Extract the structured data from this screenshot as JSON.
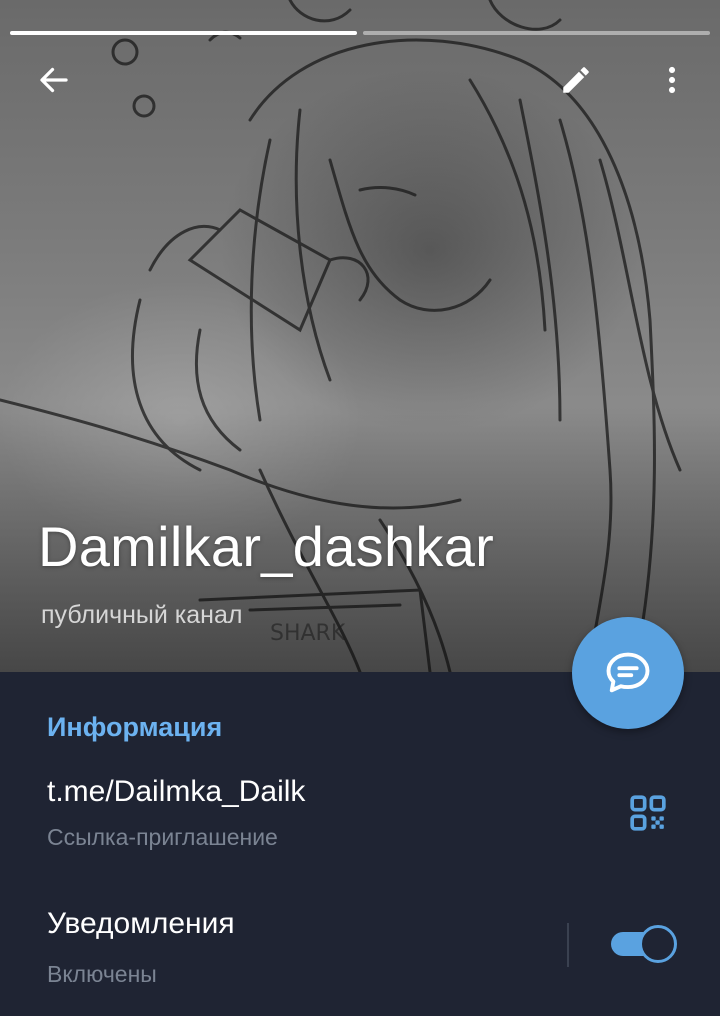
{
  "header": {
    "channel_name": "Damilkar_dashkar",
    "channel_type": "публичный канал",
    "story_progress": [
      1,
      0
    ],
    "icons": {
      "back": "arrow-left-icon",
      "edit": "pencil-icon",
      "more": "more-vertical-icon",
      "fab": "chat-bubble-icon"
    }
  },
  "info": {
    "section_title": "Информация",
    "link": {
      "value": "t.me/Dailmka_Dailk",
      "label": "Ссылка-приглашение",
      "icon": "qr-code-icon"
    },
    "notifications": {
      "title": "Уведомления",
      "status": "Включены",
      "enabled": true
    }
  },
  "colors": {
    "accent": "#5aa2e0",
    "section_title": "#6cb2f0",
    "panel_bg": "#1f2433",
    "secondary_text": "#7b8493"
  }
}
